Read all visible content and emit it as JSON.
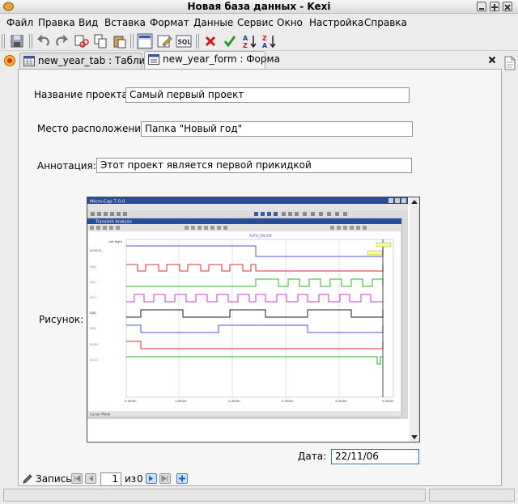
{
  "window": {
    "title": "Новая база данных - Kexi"
  },
  "menu": [
    "Файл",
    "Правка",
    "Вид",
    "Вставка",
    "Формат",
    "Данные",
    "Сервис",
    "Окно",
    "Настройка",
    "Справка"
  ],
  "toolbar": {
    "sql_label": "SQL"
  },
  "tabs": [
    {
      "label": "new_year_tab : Таблица"
    },
    {
      "label": "new_year_form : Форма"
    }
  ],
  "form": {
    "name_label": "Название проекта:",
    "name_value": "Самый первый проект",
    "location_label": "Место расположения:",
    "location_value": "Папка \"Новый год\"",
    "annotation_label": "Аннотация:",
    "annotation_value": "Этот проект является первой прикидкой",
    "picture_label": "Рисунок:",
    "date_label": "Дата:",
    "date_value": "22/11/06"
  },
  "record_nav": {
    "label": "Запись:",
    "current": "1",
    "of_label": "из",
    "total": "0"
  },
  "picture": {
    "app_title": "Micro-Cap 7.0.0",
    "window_title": "Transient Analysis",
    "status": "Cursor Mode",
    "top_marker": "AUTO_ON OFF",
    "col_header": "Left  Right",
    "signal_labels": [
      "KOMUTA",
      "D(4)",
      "D(0)",
      "D(7)",
      "D(8)",
      "D(3)",
      "D(10)",
      "D(11)"
    ],
    "x_ticks": [
      "0.000m",
      "1.000m",
      "2.000m",
      "3.000m",
      "4.000m",
      "5.000m"
    ],
    "colors": {
      "blue": "#4a55d8",
      "red": "#e03030",
      "green": "#30b030",
      "magenta": "#d23ad2",
      "black": "#202020"
    }
  }
}
